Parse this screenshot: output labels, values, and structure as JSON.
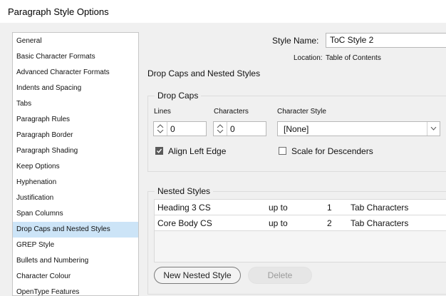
{
  "window": {
    "title": "Paragraph Style Options"
  },
  "sidebar": {
    "items": [
      {
        "label": "General"
      },
      {
        "label": "Basic Character Formats"
      },
      {
        "label": "Advanced Character Formats"
      },
      {
        "label": "Indents and Spacing"
      },
      {
        "label": "Tabs"
      },
      {
        "label": "Paragraph Rules"
      },
      {
        "label": "Paragraph Border"
      },
      {
        "label": "Paragraph Shading"
      },
      {
        "label": "Keep Options"
      },
      {
        "label": "Hyphenation"
      },
      {
        "label": "Justification"
      },
      {
        "label": "Span Columns"
      },
      {
        "label": "Drop Caps and Nested Styles",
        "selected": true
      },
      {
        "label": "GREP Style"
      },
      {
        "label": "Bullets and Numbering"
      },
      {
        "label": "Character Colour"
      },
      {
        "label": "OpenType Features"
      }
    ]
  },
  "header": {
    "style_name_label": "Style Name:",
    "style_name_value": "ToC Style 2",
    "location_label": "Location:",
    "location_value": "Table of Contents"
  },
  "section_title": "Drop Caps and Nested Styles",
  "drop_caps": {
    "group_label": "Drop Caps",
    "lines_label": "Lines",
    "lines_value": "0",
    "characters_label": "Characters",
    "characters_value": "0",
    "character_style_label": "Character Style",
    "character_style_value": "[None]",
    "align_left_edge_label": "Align Left Edge",
    "align_left_edge_checked": true,
    "scale_descenders_label": "Scale for Descenders",
    "scale_descenders_checked": false
  },
  "nested_styles": {
    "group_label": "Nested Styles",
    "rows": [
      {
        "style": "Heading 3 CS",
        "rel": "up to",
        "count": "1",
        "item": "Tab Characters"
      },
      {
        "style": "Core Body CS",
        "rel": "up to",
        "count": "2",
        "item": "Tab Characters"
      }
    ],
    "new_button": "New Nested Style",
    "delete_button": "Delete"
  },
  "colors": {
    "selected_item_bg": "#cce4f7",
    "window_bg": "#f0f0f0",
    "checkbox_checked": "#5a5a5a"
  }
}
